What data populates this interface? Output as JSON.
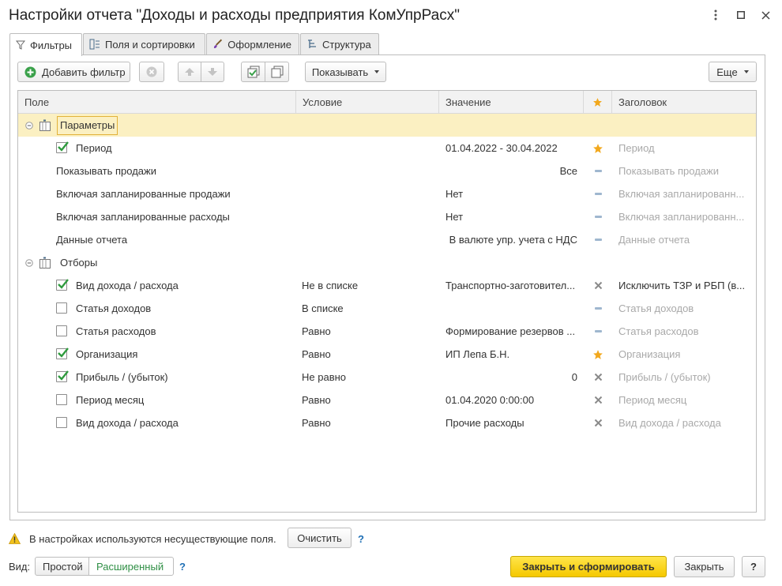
{
  "window": {
    "title": "Настройки отчета \"Доходы и расходы предприятия КомУпрРасх\""
  },
  "tabs": [
    {
      "label": "Фильтры",
      "icon": "filter-icon",
      "active": true
    },
    {
      "label": "Поля и сортировки",
      "icon": "fields-icon",
      "active": false
    },
    {
      "label": "Оформление",
      "icon": "brush-icon",
      "active": false
    },
    {
      "label": "Структура",
      "icon": "structure-icon",
      "active": false
    }
  ],
  "toolbar": {
    "add_filter": "Добавить фильтр",
    "show": "Показывать",
    "more": "Еще"
  },
  "grid": {
    "headers": {
      "field": "Поле",
      "condition": "Условие",
      "value": "Значение",
      "title": "Заголовок"
    },
    "groups": [
      {
        "label": "Параметры",
        "rows": [
          {
            "checkbox": true,
            "checked": true,
            "field": "Период",
            "condition": "",
            "value": "01.04.2022 - 30.04.2022",
            "value_align": "left",
            "mark": "star",
            "title": "Период",
            "title_muted": true
          },
          {
            "checkbox": false,
            "checked": false,
            "field": "Показывать продажи",
            "condition": "",
            "value": "Все",
            "value_align": "right",
            "mark": "dash",
            "title": "Показывать продажи",
            "title_muted": true
          },
          {
            "checkbox": false,
            "checked": false,
            "field": "Включая запланированные продажи",
            "condition": "",
            "value": "Нет",
            "value_align": "left",
            "mark": "dash",
            "title": "Включая запланированн...",
            "title_muted": true
          },
          {
            "checkbox": false,
            "checked": false,
            "field": "Включая запланированные расходы",
            "condition": "",
            "value": "Нет",
            "value_align": "left",
            "mark": "dash",
            "title": "Включая запланированн...",
            "title_muted": true
          },
          {
            "checkbox": false,
            "checked": false,
            "field": "Данные отчета",
            "condition": "",
            "value": "В валюте упр. учета с НДС",
            "value_align": "right",
            "mark": "dash",
            "title": "Данные отчета",
            "title_muted": true
          }
        ]
      },
      {
        "label": "Отборы",
        "rows": [
          {
            "checkbox": true,
            "checked": true,
            "field": "Вид дохода / расхода",
            "condition": "Не в списке",
            "value": "Транспортно-заготовител...",
            "value_align": "left",
            "mark": "cross",
            "title": "Исключить ТЗР и РБП (в...",
            "title_muted": false
          },
          {
            "checkbox": true,
            "checked": false,
            "field": "Статья доходов",
            "condition": "В списке",
            "value": "",
            "value_align": "left",
            "mark": "dash",
            "title": "Статья доходов",
            "title_muted": true
          },
          {
            "checkbox": true,
            "checked": false,
            "field": "Статья расходов",
            "condition": "Равно",
            "value": "Формирование резервов ...",
            "value_align": "left",
            "mark": "dash",
            "title": "Статья расходов",
            "title_muted": true
          },
          {
            "checkbox": true,
            "checked": true,
            "field": "Организация",
            "condition": "Равно",
            "value": "ИП Лепа Б.Н.",
            "value_align": "left",
            "mark": "star",
            "title": "Организация",
            "title_muted": true
          },
          {
            "checkbox": true,
            "checked": true,
            "field": "Прибыль / (убыток)",
            "condition": "Не равно",
            "value": "0",
            "value_align": "right",
            "mark": "cross",
            "title": "Прибыль / (убыток)",
            "title_muted": true
          },
          {
            "checkbox": true,
            "checked": false,
            "field": "Период месяц",
            "condition": "Равно",
            "value": "01.04.2020 0:00:00",
            "value_align": "left",
            "mark": "cross",
            "title": "Период месяц",
            "title_muted": true
          },
          {
            "checkbox": true,
            "checked": false,
            "field": "Вид дохода / расхода",
            "condition": "Равно",
            "value": "Прочие расходы",
            "value_align": "left",
            "mark": "cross",
            "title": "Вид дохода / расхода",
            "title_muted": true
          }
        ]
      }
    ]
  },
  "footer": {
    "warning": "В настройках используются несуществующие поля.",
    "clear": "Очистить",
    "help": "?",
    "view_label": "Вид:",
    "view_simple": "Простой",
    "view_extended": "Расширенный",
    "submit": "Закрыть и сформировать",
    "close": "Закрыть",
    "help_button": "?"
  },
  "colors": {
    "accent_green": "#3aa14a",
    "star": "#f2a81d",
    "selected_row": "#fbf0c2",
    "primary_button": "#f5c800"
  }
}
